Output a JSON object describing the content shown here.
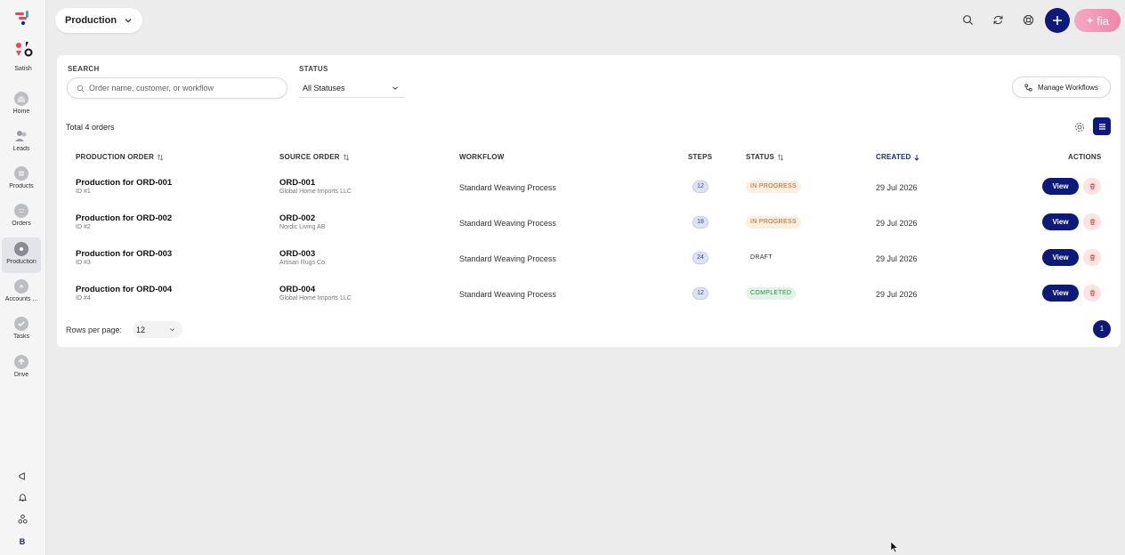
{
  "sidebar": {
    "user_name": "Satish",
    "items": [
      {
        "label": "Home",
        "icon": "home-icon"
      },
      {
        "label": "Leads",
        "icon": "leads-icon"
      },
      {
        "label": "Products",
        "icon": "products-icon"
      },
      {
        "label": "Orders",
        "icon": "orders-icon"
      },
      {
        "label": "Production",
        "icon": "production-icon",
        "active": true
      },
      {
        "label": "Accounts ...",
        "icon": "accounts-icon"
      },
      {
        "label": "Tasks",
        "icon": "tasks-icon"
      },
      {
        "label": "Drive",
        "icon": "drive-icon"
      }
    ],
    "avatar_letter": "B"
  },
  "topbar": {
    "workspace": "Production",
    "fia_label": "fia"
  },
  "filters": {
    "search_label": "SEARCH",
    "search_placeholder": "Order name, customer, or workflow",
    "status_label": "STATUS",
    "status_value": "All Statuses",
    "manage_workflows": "Manage Workflows"
  },
  "summary": {
    "total": "Total 4 orders"
  },
  "table": {
    "headers": {
      "production_order": "PRODUCTION ORDER",
      "source_order": "SOURCE ORDER",
      "workflow": "WORKFLOW",
      "steps": "STEPS",
      "status": "STATUS",
      "created": "CREATED",
      "actions": "ACTIONS"
    },
    "rows": [
      {
        "name": "Production for ORD-001",
        "id": "ID #1",
        "source": "ORD-001",
        "customer": "Global Home Imports LLC",
        "workflow": "Standard Weaving Process",
        "steps": "12",
        "status": "IN PROGRESS",
        "created": "29 Jul 2026",
        "view": "View"
      },
      {
        "name": "Production for ORD-002",
        "id": "ID #2",
        "source": "ORD-002",
        "customer": "Nordic Living AB",
        "workflow": "Standard Weaving Process",
        "steps": "18",
        "status": "IN PROGRESS",
        "created": "29 Jul 2026",
        "view": "View"
      },
      {
        "name": "Production for ORD-003",
        "id": "ID #3",
        "source": "ORD-003",
        "customer": "Artisan Rugs Co.",
        "workflow": "Standard Weaving Process",
        "steps": "24",
        "status": "DRAFT",
        "created": "29 Jul 2026",
        "view": "View"
      },
      {
        "name": "Production for ORD-004",
        "id": "ID #4",
        "source": "ORD-004",
        "customer": "Global Home Imports LLC",
        "workflow": "Standard Weaving Process",
        "steps": "12",
        "status": "COMPLETED",
        "created": "29 Jul 2026",
        "view": "View"
      }
    ]
  },
  "pagination": {
    "rows_per_page_label": "Rows per page:",
    "rows_per_page": "12",
    "current_page": "1"
  },
  "colors": {
    "primary": "#0d1a7a",
    "in_progress": "#b5651d",
    "completed": "#2e8b4a",
    "delete_bg": "#fde3e3"
  }
}
